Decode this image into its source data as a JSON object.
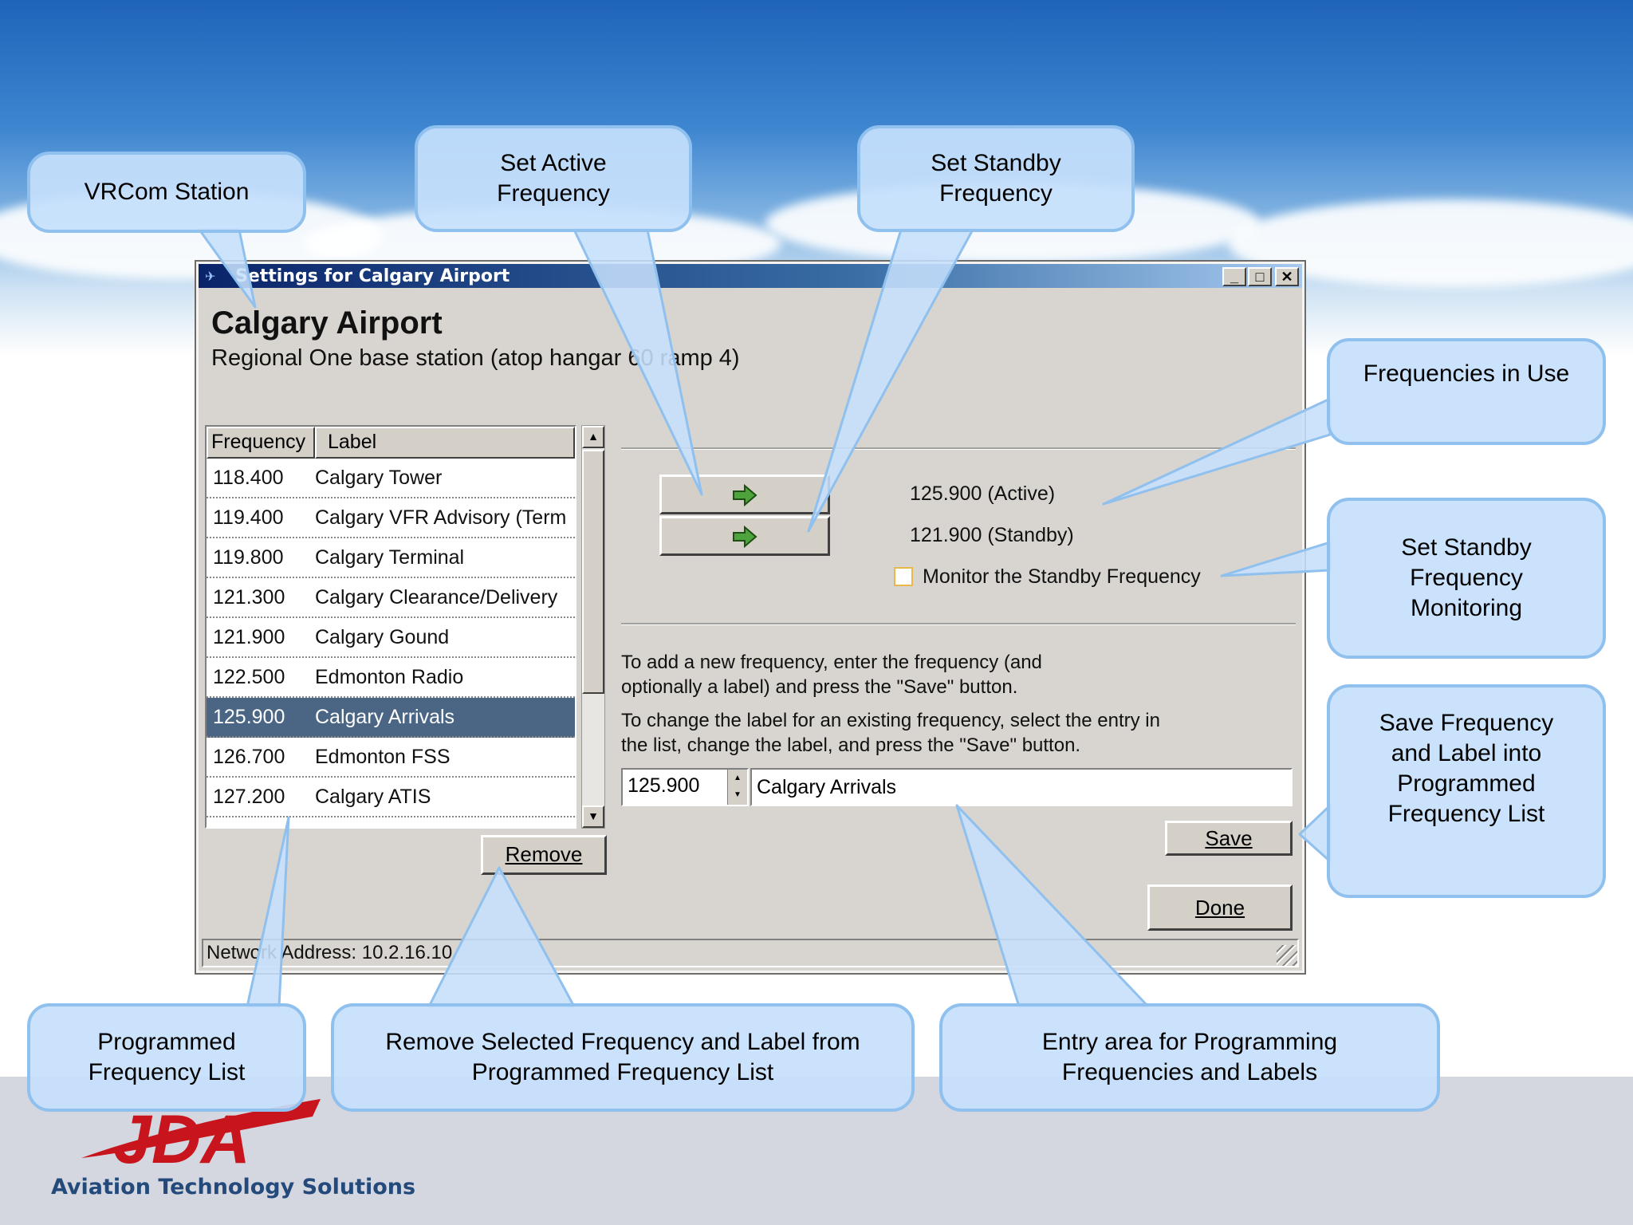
{
  "window": {
    "title": "Settings for Calgary Airport",
    "minimize": "_",
    "maximize": "□",
    "close": "✕",
    "heading": "Calgary Airport",
    "subheading": "Regional One base station (atop hangar 60 ramp 4)",
    "list": {
      "columns": [
        "Frequency",
        "Label"
      ],
      "rows": [
        {
          "freq": "118.400",
          "label": "Calgary Tower"
        },
        {
          "freq": "119.400",
          "label": "Calgary VFR Advisory (Term"
        },
        {
          "freq": "119.800",
          "label": "Calgary Terminal"
        },
        {
          "freq": "121.300",
          "label": "Calgary Clearance/Delivery"
        },
        {
          "freq": "121.900",
          "label": "Calgary Gound"
        },
        {
          "freq": "122.500",
          "label": "Edmonton Radio"
        },
        {
          "freq": "125.900",
          "label": "Calgary Arrivals",
          "selected": true
        },
        {
          "freq": "126.700",
          "label": "Edmonton FSS"
        },
        {
          "freq": "127.200",
          "label": "Calgary ATIS"
        }
      ]
    },
    "remove_label": "Remove",
    "active_freq": "125.900 (Active)",
    "standby_freq": "121.900 (Standby)",
    "monitor_label": "Monitor the Standby Frequency",
    "help_add": "To add a new frequency, enter the frequency (and\noptionally a label) and press the \"Save\" button.",
    "help_change": "To change the label for an existing frequency, select the entry in\nthe list, change the label, and press the \"Save\" button.",
    "entry_frequency": "125.900",
    "entry_label": "Calgary Arrivals",
    "save_label": "Save",
    "done_label": "Done",
    "status": "Network Address: 10.2.16.10"
  },
  "callouts": {
    "vrcom_station": "VRCom Station",
    "set_active": "Set Active\nFrequency",
    "set_standby": "Set Standby\nFrequency",
    "frequencies_in_use": "Frequencies in Use",
    "standby_monitoring": "Set Standby\nFrequency\nMonitoring",
    "save_frequency": "Save Frequency\nand Label into\nProgrammed\nFrequency List",
    "programmed_list": "Programmed\nFrequency List",
    "remove_selected": "Remove Selected Frequency and Label from\nProgrammed Frequency List",
    "entry_area": "Entry area for Programming\nFrequencies and Labels"
  },
  "logo": {
    "text": "JDA",
    "tagline": "Aviation Technology Solutions"
  },
  "colors": {
    "accent": "#4a6684",
    "callout_fill": "#c6dffc",
    "logo_red": "#c8141c"
  }
}
